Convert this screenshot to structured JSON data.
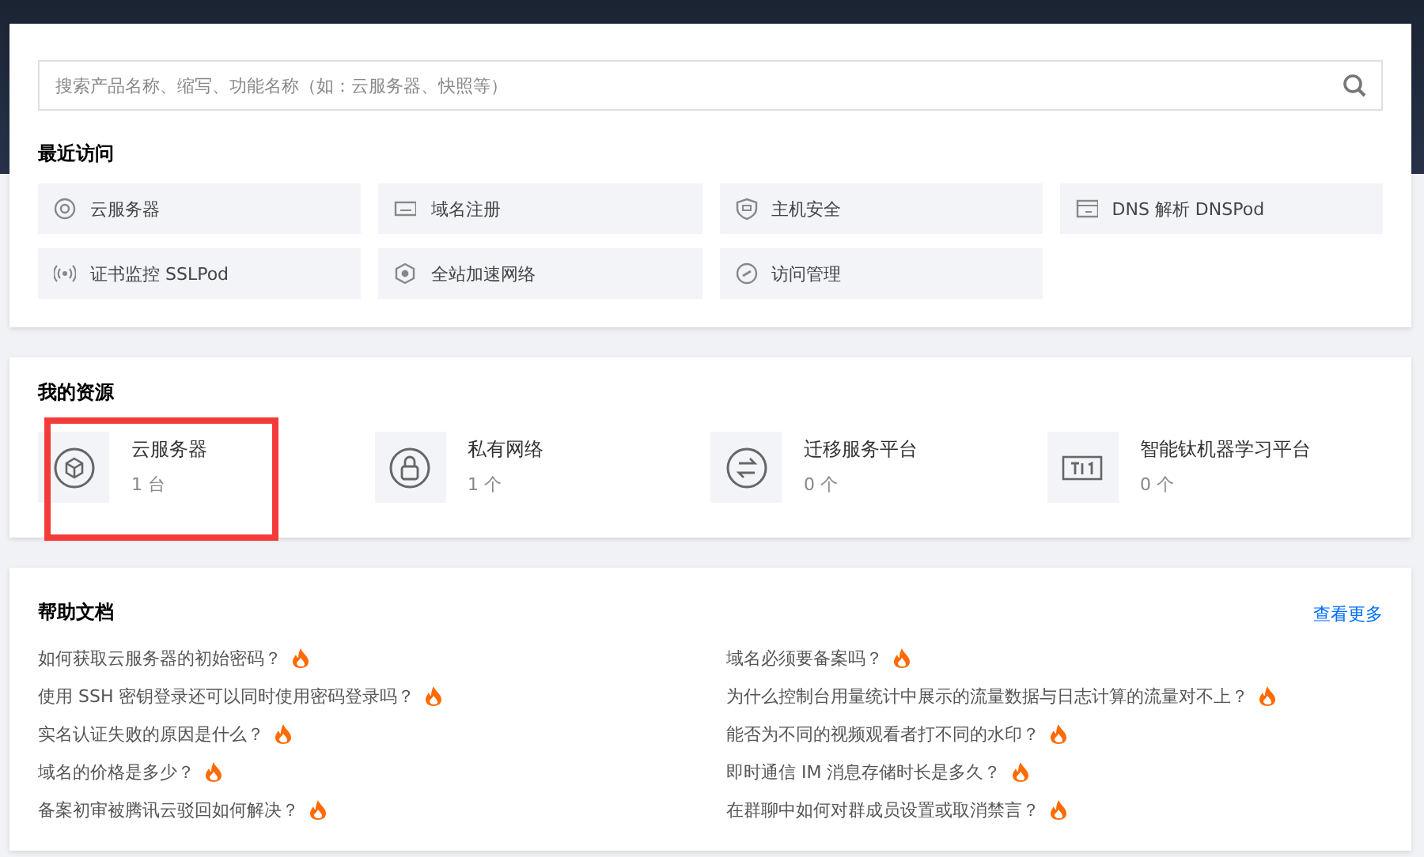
{
  "search": {
    "placeholder": "搜索产品名称、缩写、功能名称（如：云服务器、快照等）"
  },
  "recent": {
    "title": "最近访问",
    "items": [
      {
        "label": "云服务器",
        "kind": "server"
      },
      {
        "label": "域名注册",
        "kind": "domain"
      },
      {
        "label": "主机安全",
        "kind": "shield"
      },
      {
        "label": "DNS 解析 DNSPod",
        "kind": "dns"
      },
      {
        "label": "证书监控 SSLPod",
        "kind": "signal"
      },
      {
        "label": "全站加速网络",
        "kind": "hexagon"
      },
      {
        "label": "访问管理",
        "kind": "link"
      }
    ]
  },
  "resources": {
    "title": "我的资源",
    "items": [
      {
        "name": "云服务器",
        "count": "1 台",
        "kind": "cube",
        "highlighted": true
      },
      {
        "name": "私有网络",
        "count": "1 个",
        "kind": "lock",
        "highlighted": false
      },
      {
        "name": "迁移服务平台",
        "count": "0 个",
        "kind": "arrows",
        "highlighted": false
      },
      {
        "name": "智能钛机器学习平台",
        "count": "0 个",
        "kind": "ti",
        "highlighted": false
      }
    ]
  },
  "help": {
    "title": "帮助文档",
    "more": "查看更多",
    "items": [
      {
        "text": "如何获取云服务器的初始密码？",
        "hot": true
      },
      {
        "text": "域名必须要备案吗？",
        "hot": true
      },
      {
        "text": "使用 SSH 密钥登录还可以同时使用密码登录吗？",
        "hot": true
      },
      {
        "text": "为什么控制台用量统计中展示的流量数据与日志计算的流量对不上？",
        "hot": true
      },
      {
        "text": "实名认证失败的原因是什么？",
        "hot": true
      },
      {
        "text": "能否为不同的视频观看者打不同的水印？",
        "hot": true
      },
      {
        "text": "域名的价格是多少？",
        "hot": true
      },
      {
        "text": "即时通信 IM 消息存储时长是多久？",
        "hot": true
      },
      {
        "text": "备案初审被腾讯云驳回如何解决？",
        "hot": true
      },
      {
        "text": "在群聊中如何对群成员设置或取消禁言？",
        "hot": true
      }
    ]
  }
}
